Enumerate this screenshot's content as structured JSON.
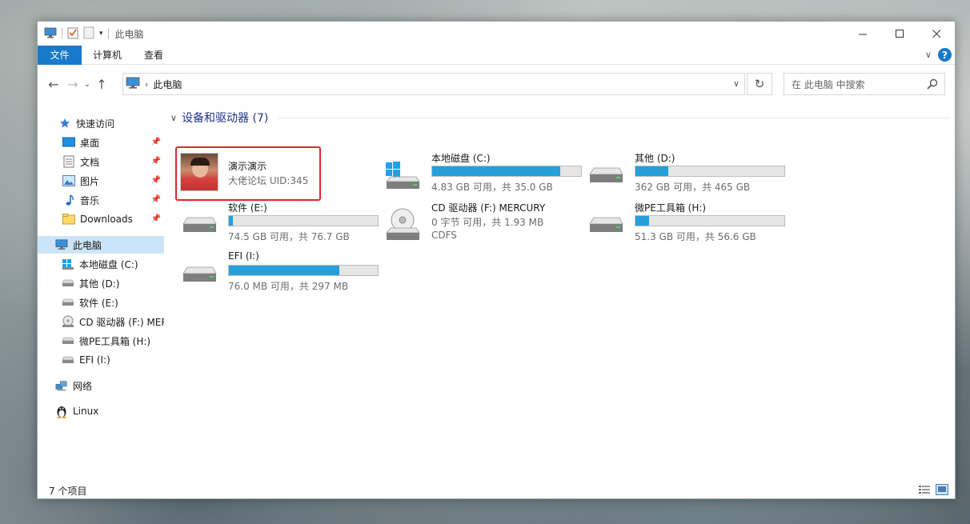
{
  "window": {
    "title": "此电脑"
  },
  "ribbon": {
    "tabs": [
      {
        "label": "文件",
        "active": true
      },
      {
        "label": "计算机",
        "active": false
      },
      {
        "label": "查看",
        "active": false
      }
    ]
  },
  "address": {
    "path": "此电脑",
    "search_placeholder": "在 此电脑 中搜索"
  },
  "sidebar": {
    "quick_access": "快速访问",
    "quick_items": [
      {
        "label": "桌面",
        "icon": "desktop-icon"
      },
      {
        "label": "文档",
        "icon": "documents-icon"
      },
      {
        "label": "图片",
        "icon": "pictures-icon"
      },
      {
        "label": "音乐",
        "icon": "music-icon"
      },
      {
        "label": "Downloads",
        "icon": "downloads-icon"
      }
    ],
    "this_pc": "此电脑",
    "drives": [
      {
        "label": "本地磁盘 (C:)",
        "icon": "windows-drive-icon"
      },
      {
        "label": "其他 (D:)",
        "icon": "drive-icon"
      },
      {
        "label": "软件 (E:)",
        "icon": "drive-icon"
      },
      {
        "label": "CD 驱动器 (F:) MERCURY",
        "icon": "cd-drive-icon"
      },
      {
        "label": "微PE工具箱 (H:)",
        "icon": "drive-icon"
      },
      {
        "label": "EFI (I:)",
        "icon": "drive-icon"
      }
    ],
    "network": "网络",
    "linux": "Linux"
  },
  "content": {
    "group_title": "设备和驱动器 (7)",
    "user_tile": {
      "name": "演示演示",
      "sub": "大佬论坛 UID:345"
    },
    "drives": [
      {
        "name": "本地磁盘 (C:)",
        "free": "4.83 GB 可用，共 35.0 GB",
        "used_fraction": 0.862,
        "icon": "windows-drive-icon"
      },
      {
        "name": "其他 (D:)",
        "free": "362 GB 可用，共 465 GB",
        "used_fraction": 0.221,
        "icon": "drive-icon"
      },
      {
        "name": "软件 (E:)",
        "free": "74.5 GB 可用，共 76.7 GB",
        "used_fraction": 0.029,
        "icon": "drive-icon"
      },
      {
        "name": "CD 驱动器 (F:) MERCURY",
        "free": "0 字节 可用，共 1.93 MB",
        "fs": "CDFS",
        "icon": "cd-drive-icon"
      },
      {
        "name": "微PE工具箱 (H:)",
        "free": "51.3 GB 可用，共 56.6 GB",
        "used_fraction": 0.094,
        "icon": "drive-icon"
      },
      {
        "name": "EFI (I:)",
        "free": "76.0 MB 可用，共 297 MB",
        "used_fraction": 0.744,
        "icon": "drive-icon"
      }
    ]
  },
  "status": {
    "count": "7 个项目"
  },
  "colors": {
    "accent": "#1979ca",
    "bar_fill": "#26a0da",
    "highlight": "#e5262a",
    "group_title": "#1e3287"
  }
}
